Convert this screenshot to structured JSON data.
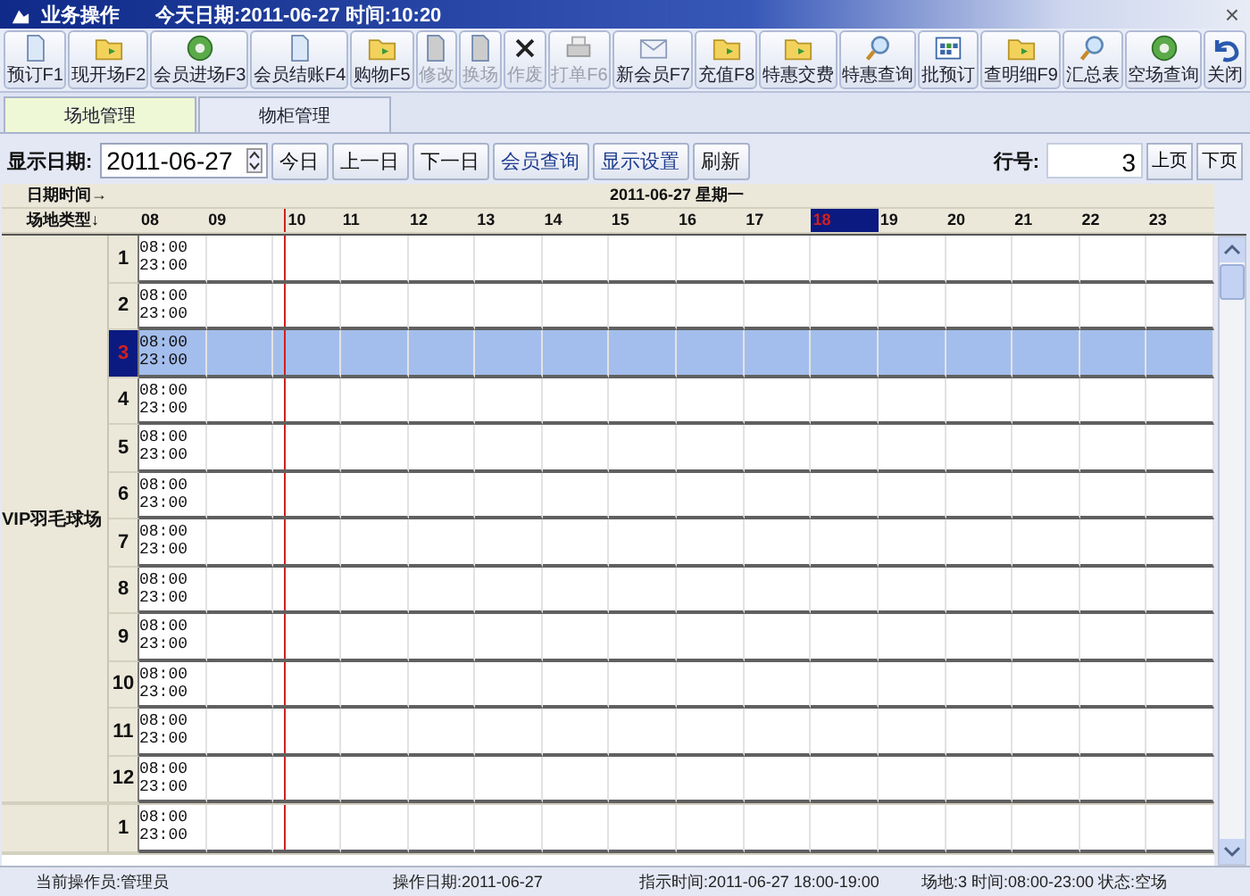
{
  "window": {
    "title": "业务操作",
    "info": "今天日期:2011-06-27 时间:10:20",
    "close": "×"
  },
  "toolbar": [
    {
      "label": "预订F1",
      "kind": "doc",
      "disabled": false
    },
    {
      "label": "现开场F2",
      "kind": "folder",
      "disabled": false
    },
    {
      "label": "会员进场F3",
      "kind": "disc",
      "disabled": false
    },
    {
      "label": "会员结账F4",
      "kind": "doc",
      "disabled": false
    },
    {
      "label": "购物F5",
      "kind": "folder",
      "disabled": false
    },
    {
      "label": "修改",
      "kind": "doc",
      "disabled": true
    },
    {
      "label": "换场",
      "kind": "doc",
      "disabled": true
    },
    {
      "label": "作废",
      "kind": "cross",
      "disabled": true
    },
    {
      "label": "打单F6",
      "kind": "printer",
      "disabled": true
    },
    {
      "label": "新会员F7",
      "kind": "mail",
      "disabled": false
    },
    {
      "label": "充值F8",
      "kind": "folder",
      "disabled": false
    },
    {
      "label": "特惠交费",
      "kind": "folder",
      "disabled": false
    },
    {
      "label": "特惠查询",
      "kind": "search",
      "disabled": false
    },
    {
      "label": "批预订",
      "kind": "grid",
      "disabled": false
    },
    {
      "label": "查明细F9",
      "kind": "folder",
      "disabled": false
    },
    {
      "label": "汇总表",
      "kind": "search",
      "disabled": false
    },
    {
      "label": "空场查询",
      "kind": "disc",
      "disabled": false
    },
    {
      "label": "关闭",
      "kind": "undo",
      "disabled": false
    }
  ],
  "tabs": [
    {
      "label": "场地管理",
      "selected": true
    },
    {
      "label": "物柜管理",
      "selected": false
    }
  ],
  "filter": {
    "date_label": "显示日期:",
    "date_value": "2011-06-27",
    "buttons": [
      "今日",
      "上一日",
      "下一日",
      "会员查询",
      "显示设置",
      "刷新"
    ],
    "row_label": "行号:",
    "row_value": "3",
    "page_buttons": [
      "上页",
      "下页"
    ]
  },
  "grid": {
    "corner_top": "日期时间→",
    "date_header": "2011-06-27 星期一",
    "corner_bottom": "场地类型↓",
    "hours": [
      {
        "label": "08",
        "selected": false,
        "current": false
      },
      {
        "label": "09",
        "selected": false,
        "current": false
      },
      {
        "label": "10",
        "selected": false,
        "current": true
      },
      {
        "label": "11",
        "selected": false,
        "current": false
      },
      {
        "label": "12",
        "selected": false,
        "current": false
      },
      {
        "label": "13",
        "selected": false,
        "current": false
      },
      {
        "label": "14",
        "selected": false,
        "current": false
      },
      {
        "label": "15",
        "selected": false,
        "current": false
      },
      {
        "label": "16",
        "selected": false,
        "current": false
      },
      {
        "label": "17",
        "selected": false,
        "current": false
      },
      {
        "label": "18",
        "selected": true,
        "current": false
      },
      {
        "label": "19",
        "selected": false,
        "current": false
      },
      {
        "label": "20",
        "selected": false,
        "current": false
      },
      {
        "label": "21",
        "selected": false,
        "current": false
      },
      {
        "label": "22",
        "selected": false,
        "current": false
      },
      {
        "label": "23",
        "selected": false,
        "current": false
      }
    ],
    "courts": [
      {
        "name": "VIP羽毛球场",
        "rows": [
          {
            "number": "1",
            "open": "08:00",
            "close": "23:00",
            "selected": false
          },
          {
            "number": "2",
            "open": "08:00",
            "close": "23:00",
            "selected": false
          },
          {
            "number": "3",
            "open": "08:00",
            "close": "23:00",
            "selected": true
          },
          {
            "number": "4",
            "open": "08:00",
            "close": "23:00",
            "selected": false
          },
          {
            "number": "5",
            "open": "08:00",
            "close": "23:00",
            "selected": false
          },
          {
            "number": "6",
            "open": "08:00",
            "close": "23:00",
            "selected": false
          },
          {
            "number": "7",
            "open": "08:00",
            "close": "23:00",
            "selected": false
          },
          {
            "number": "8",
            "open": "08:00",
            "close": "23:00",
            "selected": false
          },
          {
            "number": "9",
            "open": "08:00",
            "close": "23:00",
            "selected": false
          },
          {
            "number": "10",
            "open": "08:00",
            "close": "23:00",
            "selected": false
          },
          {
            "number": "11",
            "open": "08:00",
            "close": "23:00",
            "selected": false
          },
          {
            "number": "12",
            "open": "08:00",
            "close": "23:00",
            "selected": false
          }
        ]
      },
      {
        "rows": [
          {
            "number": "1",
            "open": "08:00",
            "close": "23:00",
            "selected": false
          }
        ]
      }
    ]
  },
  "status_bar": [
    "当前操作员:管理员",
    "操作日期:2011-06-27",
    "指示时间:2011-06-27 18:00-19:00",
    "场地:3 时间:08:00-23:00 状态:空场"
  ]
}
